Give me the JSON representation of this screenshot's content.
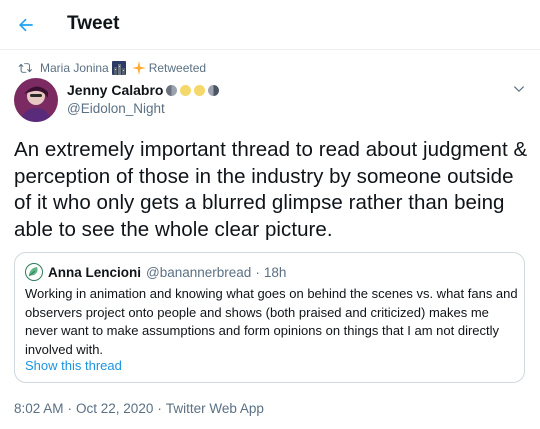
{
  "header": {
    "title": "Tweet",
    "back_icon": "arrow-left-icon"
  },
  "retweet": {
    "icon": "retweet-icon",
    "user": "Maria Jonina",
    "label": "Retweeted"
  },
  "author": {
    "name": "Jenny Calabro",
    "handle": "@Eidolon_Night"
  },
  "tweet": {
    "text": "An extremely important thread to read about judgment & perception of those in the industry by someone outside of it who only gets a blurred glimpse rather than being able to see the whole clear picture."
  },
  "quote": {
    "name": "Anna Lencioni",
    "handle": "@banannerbread",
    "dot": "·",
    "time": "18h",
    "text": "Working in animation and knowing what goes on behind the scenes vs. what fans and observers project onto people and shows (both praised and criticized) makes me never want to make assumptions and form opinions on things that I am not directly involved with.",
    "show_thread": "Show this thread"
  },
  "meta": {
    "time": "8:02 AM",
    "sep": "·",
    "date": "Oct 22, 2020",
    "source": "Twitter Web App"
  },
  "colors": {
    "accent": "#1da1f2",
    "link": "#1b95e0",
    "secondary": "#5b7083"
  }
}
